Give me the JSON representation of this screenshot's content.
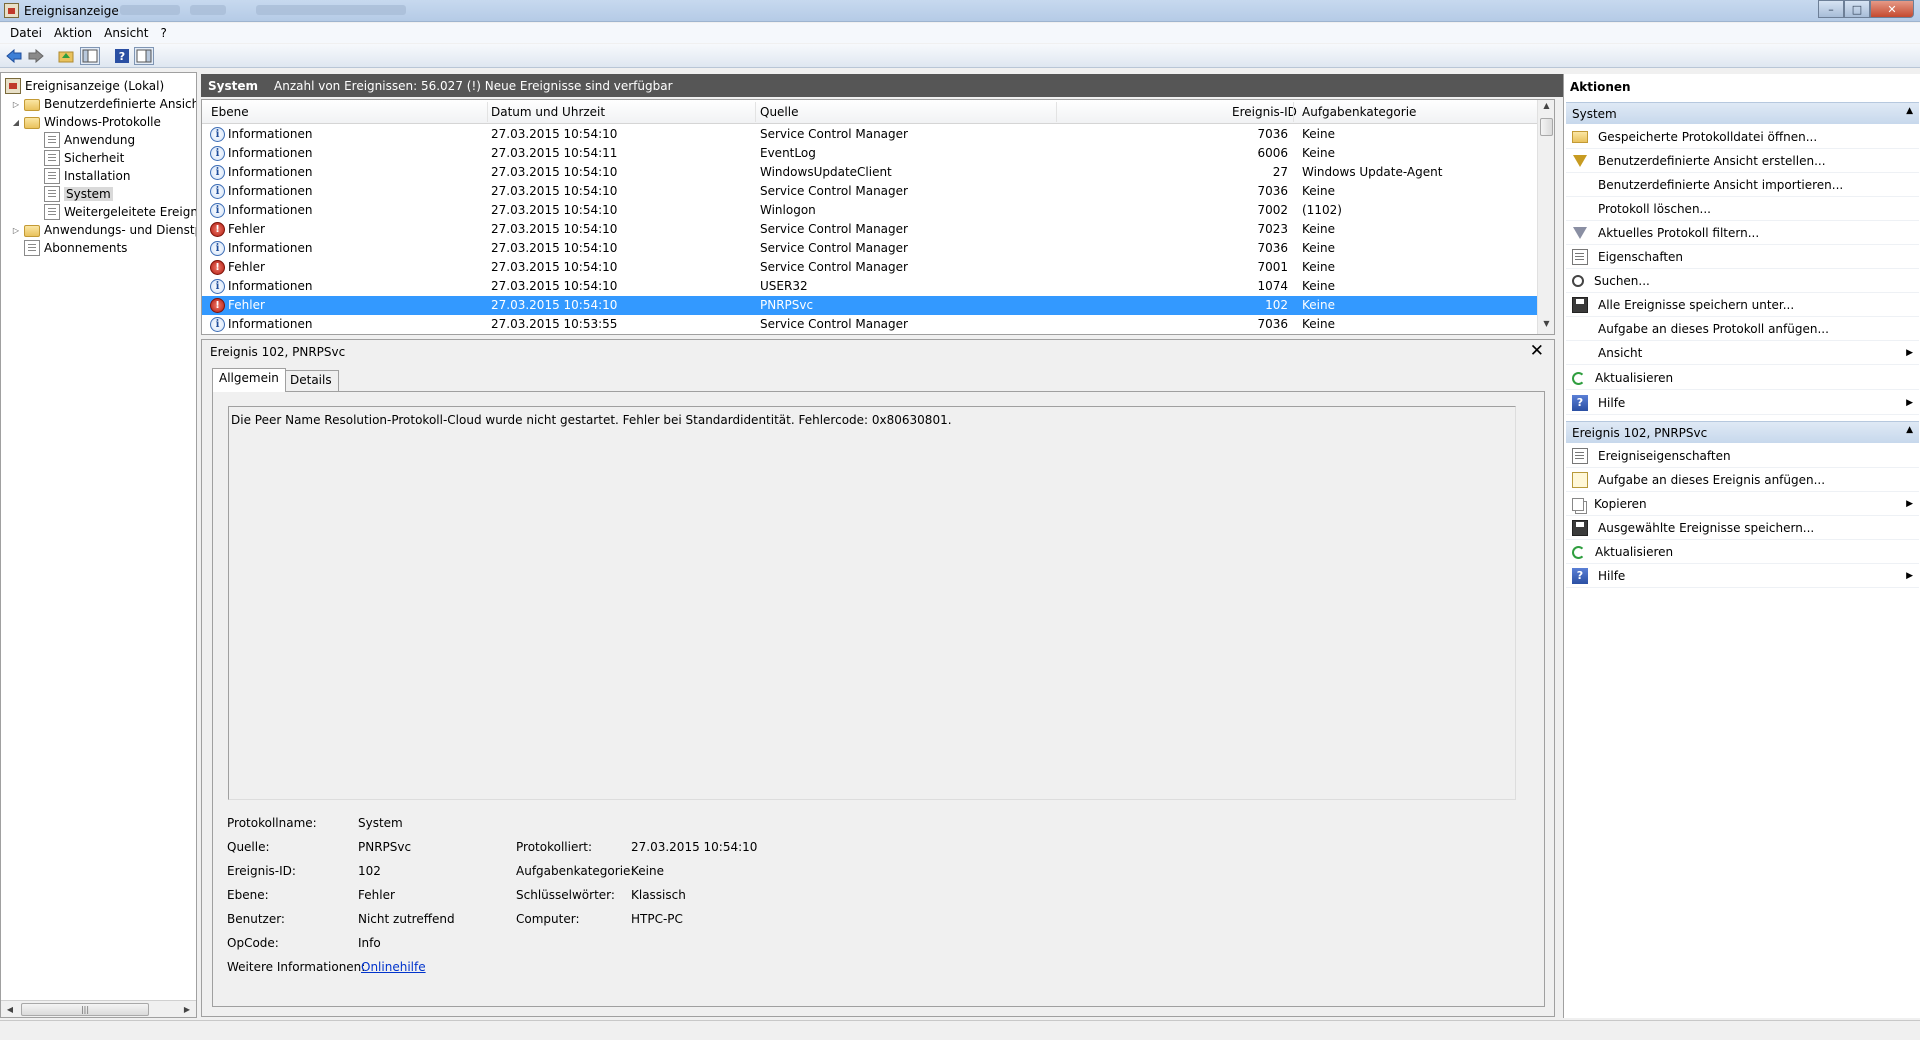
{
  "window": {
    "title": "Ereignisanzeige"
  },
  "menu": [
    {
      "label": "Datei"
    },
    {
      "label": "Aktion"
    },
    {
      "label": "Ansicht"
    },
    {
      "label": "?"
    }
  ],
  "tree": {
    "items": [
      {
        "label": "Ereignisanzeige (Lokal)",
        "icon": "event-viewer-icon"
      },
      {
        "label": "Benutzerdefinierte Ansichten",
        "icon": "folder-icon"
      },
      {
        "label": "Windows-Protokolle",
        "icon": "folder-icon"
      },
      {
        "label": "Anwendung",
        "icon": "log-icon"
      },
      {
        "label": "Sicherheit",
        "icon": "log-icon"
      },
      {
        "label": "Installation",
        "icon": "log-icon"
      },
      {
        "label": "System",
        "icon": "log-icon",
        "selected": true
      },
      {
        "label": "Weitergeleitete Ereignisse",
        "icon": "log-icon"
      },
      {
        "label": "Anwendungs- und Dienstprotokolle",
        "icon": "folder-icon"
      },
      {
        "label": "Abonnements",
        "icon": "log-icon"
      }
    ]
  },
  "center": {
    "log_name": "System",
    "summary": "Anzahl von Ereignissen: 56.027 (!) Neue Ereignisse sind verfügbar"
  },
  "event_list": {
    "columns": [
      "Ebene",
      "Datum und Uhrzeit",
      "Quelle",
      "Ereignis-ID",
      "Aufgabenkategorie"
    ],
    "rows": [
      {
        "level": "Informationen",
        "type": "info",
        "date": "27.03.2015 10:54:10",
        "source": "Service Control Manager",
        "id": "7036",
        "category": "Keine"
      },
      {
        "level": "Informationen",
        "type": "info",
        "date": "27.03.2015 10:54:11",
        "source": "EventLog",
        "id": "6006",
        "category": "Keine"
      },
      {
        "level": "Informationen",
        "type": "info",
        "date": "27.03.2015 10:54:10",
        "source": "WindowsUpdateClient",
        "id": "27",
        "category": "Windows Update-Agent"
      },
      {
        "level": "Informationen",
        "type": "info",
        "date": "27.03.2015 10:54:10",
        "source": "Service Control Manager",
        "id": "7036",
        "category": "Keine"
      },
      {
        "level": "Informationen",
        "type": "info",
        "date": "27.03.2015 10:54:10",
        "source": "Winlogon",
        "id": "7002",
        "category": "(1102)"
      },
      {
        "level": "Fehler",
        "type": "error",
        "date": "27.03.2015 10:54:10",
        "source": "Service Control Manager",
        "id": "7023",
        "category": "Keine"
      },
      {
        "level": "Informationen",
        "type": "info",
        "date": "27.03.2015 10:54:10",
        "source": "Service Control Manager",
        "id": "7036",
        "category": "Keine"
      },
      {
        "level": "Fehler",
        "type": "error",
        "date": "27.03.2015 10:54:10",
        "source": "Service Control Manager",
        "id": "7001",
        "category": "Keine"
      },
      {
        "level": "Informationen",
        "type": "info",
        "date": "27.03.2015 10:54:10",
        "source": "USER32",
        "id": "1074",
        "category": "Keine"
      },
      {
        "level": "Fehler",
        "type": "error",
        "date": "27.03.2015 10:54:10",
        "source": "PNRPSvc",
        "id": "102",
        "category": "Keine",
        "selected": true
      },
      {
        "level": "Informationen",
        "type": "info",
        "date": "27.03.2015 10:53:55",
        "source": "Service Control Manager",
        "id": "7036",
        "category": "Keine"
      }
    ]
  },
  "detail": {
    "title": "Ereignis 102, PNRPSvc",
    "tabs": [
      "Allgemein",
      "Details"
    ],
    "message": "Die Peer Name Resolution-Protokoll-Cloud wurde nicht gestartet. Fehler bei Standardidentität. Fehlercode: 0x80630801.",
    "labels": {
      "protokollname": "Protokollname:",
      "quelle": "Quelle:",
      "ereignis_id": "Ereignis-ID:",
      "ebene": "Ebene:",
      "benutzer": "Benutzer:",
      "opcode": "OpCode:",
      "weitere": "Weitere Informationen:",
      "protokolliert": "Protokolliert:",
      "aufgabenkategorie": "Aufgabenkategorie:",
      "schluesselwoerter": "Schlüsselwörter:",
      "computer": "Computer:"
    },
    "values": {
      "protokollname": "System",
      "quelle": "PNRPSvc",
      "ereignis_id": "102",
      "ebene": "Fehler",
      "benutzer": "Nicht zutreffend",
      "opcode": "Info",
      "weitere": "Onlinehilfe",
      "protokolliert": "27.03.2015 10:54:10",
      "aufgabenkategorie": "Keine",
      "schluesselwoerter": "Klassisch",
      "computer": "HTPC-PC"
    }
  },
  "actions": {
    "title": "Aktionen",
    "sections": [
      {
        "header": "System",
        "items": [
          {
            "label": "Gespeicherte Protokolldatei öffnen...",
            "icon": "open-folder-icon"
          },
          {
            "label": "Benutzerdefinierte Ansicht erstellen...",
            "icon": "filter-icon"
          },
          {
            "label": "Benutzerdefinierte Ansicht importieren...",
            "icon": ""
          },
          {
            "label": "Protokoll löschen...",
            "icon": ""
          },
          {
            "label": "Aktuelles Protokoll filtern...",
            "icon": "filter-icon"
          },
          {
            "label": "Eigenschaften",
            "icon": "properties-icon"
          },
          {
            "label": "Suchen...",
            "icon": "search-icon"
          },
          {
            "label": "Alle Ereignisse speichern unter...",
            "icon": "save-icon"
          },
          {
            "label": "Aufgabe an dieses Protokoll anfügen...",
            "icon": ""
          },
          {
            "label": "Ansicht",
            "icon": "",
            "submenu": true
          },
          {
            "label": "Aktualisieren",
            "icon": "refresh-icon"
          },
          {
            "label": "Hilfe",
            "icon": "help-icon",
            "submenu": true
          }
        ]
      },
      {
        "header": "Ereignis 102, PNRPSvc",
        "items": [
          {
            "label": "Ereigniseigenschaften",
            "icon": "properties-icon"
          },
          {
            "label": "Aufgabe an dieses Ereignis anfügen...",
            "icon": "task-icon"
          },
          {
            "label": "Kopieren",
            "icon": "copy-icon",
            "submenu": true
          },
          {
            "label": "Ausgewählte Ereignisse speichern...",
            "icon": "save-icon"
          },
          {
            "label": "Aktualisieren",
            "icon": "refresh-icon"
          },
          {
            "label": "Hilfe",
            "icon": "help-icon",
            "submenu": true
          }
        ]
      }
    ]
  }
}
